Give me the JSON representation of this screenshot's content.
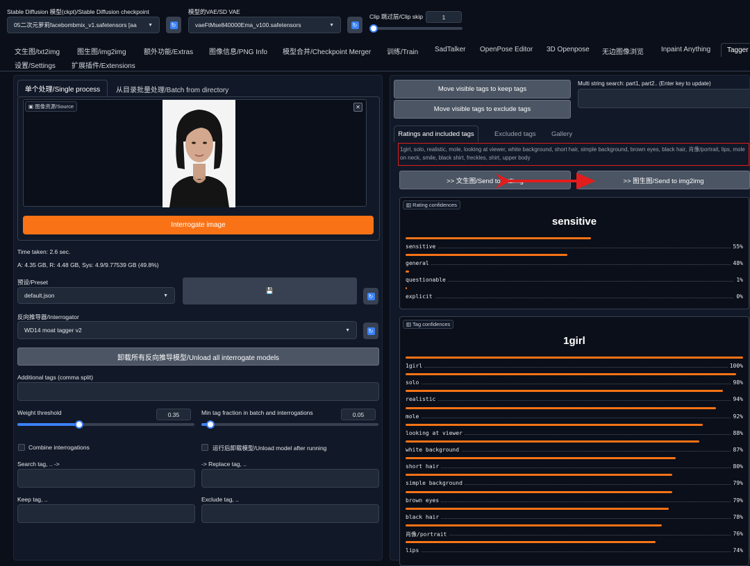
{
  "top": {
    "checkpoint_label": "Stable Diffusion 模型(ckpt)/Stable Diffusion checkpoint",
    "checkpoint_value": "05二次元萝莉facebombmix_v1.safetensors [aa",
    "vae_label": "模型的VAE/SD VAE",
    "vae_value": "vaeFtMse840000Ema_v100.safetensors",
    "clip_label": "Clip 跳过层/Clip skip",
    "clip_value": "1"
  },
  "tabs": [
    "文生图/txt2img",
    "图生图/img2img",
    "额外功能/Extras",
    "图像信息/PNG Info",
    "模型合并/Checkpoint Merger",
    "训练/Train",
    "SadTalker",
    "OpenPose Editor",
    "3D Openpose",
    "无边图像浏览",
    "Inpaint Anything",
    "Tagger",
    "设置/Settings",
    "扩展插件/Extensions"
  ],
  "left": {
    "subtab_single": "单个处理/Single process",
    "subtab_batch": "从目录批量处理/Batch from directory",
    "source_label": "图像资源/Source",
    "close_glyph": "✕",
    "interrogate_btn": "Interrogate image",
    "time_taken": "Time taken: 2.6 sec.",
    "memory": "A: 4.35 GB, R: 4.48 GB, Sys: 4.9/9.77539 GB (49.8%)",
    "preset_label": "预设/Preset",
    "preset_value": "default.json",
    "save_glyph": "💾",
    "interrogator_label": "反向推导器/Interrogator",
    "interrogator_value": "WD14 moat tagger v2",
    "unload_btn": "卸载所有反向推导模型/Unload all interrogate models",
    "additional_label": "Additional tags (comma split)",
    "weight_label": "Weight threshold",
    "weight_value": "0.35",
    "weight_fraction": 0.35,
    "min_label": "Min tag fraction in batch and interrogations",
    "min_value": "0.05",
    "min_fraction": 0.05,
    "combine_label": "Combine interrogations",
    "unload_after_label": "运行后卸载模型/Unload model after running",
    "search_label": "Search tag, .. ->",
    "replace_label": "-> Replace tag, ..",
    "keep_label": "Keep tag, ..",
    "exclude_label": "Exclude tag, .."
  },
  "right": {
    "move_keep_btn": "Move visible tags to keep tags",
    "move_exclude_btn": "Move visible tags to exclude tags",
    "multi_search_label": "Multi string search: part1, part2.. (Enter key to update)",
    "tab_ratings": "Ratings and included tags",
    "tab_excluded": "Excluded tags",
    "tab_gallery": "Gallery",
    "tags_text": "1girl, solo, realistic, mole, looking at viewer, white background, short hair, simple background, brown eyes, black hair, 肖像/portrait, lips, mole on neck, smile, black shirt, freckles, shirt, upper body",
    "send_txt2img": ">> 文生图/Send to txt2img",
    "send_img2img": ">> 图生图/Send to img2img",
    "rating_label": "Rating confidences",
    "rating_top": "sensitive",
    "ratings": [
      {
        "name": "sensitive",
        "pct": "55%",
        "v": 0.55
      },
      {
        "name": "general",
        "pct": "48%",
        "v": 0.48
      },
      {
        "name": "questionable",
        "pct": "1%",
        "v": 0.01
      },
      {
        "name": "explicit",
        "pct": "0%",
        "v": 0.0
      }
    ],
    "tag_label": "Tag confidences",
    "tag_top": "1girl",
    "tags": [
      {
        "name": "1girl",
        "pct": "100%",
        "v": 1.0
      },
      {
        "name": "solo",
        "pct": "98%",
        "v": 0.98
      },
      {
        "name": "realistic",
        "pct": "94%",
        "v": 0.94
      },
      {
        "name": "mole",
        "pct": "92%",
        "v": 0.92
      },
      {
        "name": "looking at viewer",
        "pct": "88%",
        "v": 0.88
      },
      {
        "name": "white background",
        "pct": "87%",
        "v": 0.87
      },
      {
        "name": "short hair",
        "pct": "80%",
        "v": 0.8
      },
      {
        "name": "simple background",
        "pct": "79%",
        "v": 0.79
      },
      {
        "name": "brown eyes",
        "pct": "79%",
        "v": 0.79
      },
      {
        "name": "black hair",
        "pct": "78%",
        "v": 0.78
      },
      {
        "name": "肖像/portrait",
        "pct": "76%",
        "v": 0.76
      },
      {
        "name": "lips",
        "pct": "74%",
        "v": 0.74
      }
    ]
  },
  "colors": {
    "accent": "#f97316",
    "slider": "#3b82f6",
    "annotation": "#e11d1d"
  }
}
